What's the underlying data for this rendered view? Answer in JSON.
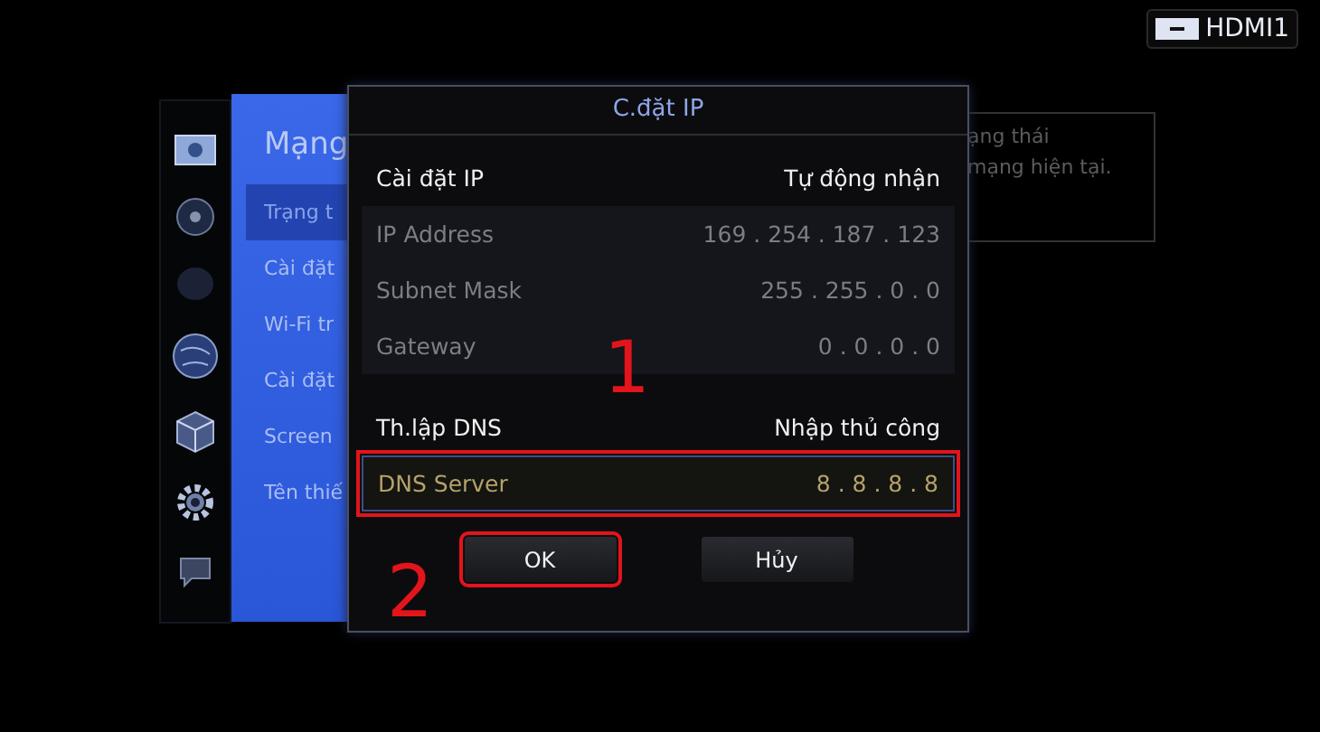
{
  "source_badge": {
    "label": "HDMI1"
  },
  "side_icons": [
    {
      "kind": "picture"
    },
    {
      "kind": "disc"
    },
    {
      "kind": "dot"
    },
    {
      "kind": "globe"
    },
    {
      "kind": "cube"
    },
    {
      "kind": "gear"
    },
    {
      "kind": "chat"
    }
  ],
  "menu": {
    "title": "Mạng",
    "items": [
      {
        "label": "Trạng t",
        "selected": true
      },
      {
        "label": "Cài đặt",
        "selected": false
      },
      {
        "label": "Wi-Fi tr",
        "selected": false
      },
      {
        "label": "Cài đặt",
        "selected": false
      },
      {
        "label": "Screen",
        "selected": false
      },
      {
        "label": "Tên thiế",
        "selected": false
      }
    ]
  },
  "info_panel": {
    "lines": [
      "ạng thái",
      "mạng hiện tại."
    ]
  },
  "dialog": {
    "title": "C.đặt IP",
    "rows": [
      {
        "label": "Cài đặt IP",
        "value": "Tự động nhận",
        "disabled": false,
        "selected": false,
        "annotated": false
      },
      {
        "label": "IP Address",
        "value": "169 . 254 . 187 . 123",
        "disabled": true,
        "selected": false,
        "annotated": false
      },
      {
        "label": "Subnet Mask",
        "value": "255 . 255 . 0 . 0",
        "disabled": true,
        "selected": false,
        "annotated": false
      },
      {
        "label": "Gateway",
        "value": "0 . 0 . 0 . 0",
        "disabled": true,
        "selected": false,
        "annotated": false
      },
      {
        "label": "Th.lập DNS",
        "value": "Nhập thủ công",
        "disabled": false,
        "selected": false,
        "annotated": false
      },
      {
        "label": "DNS Server",
        "value": "8 . 8 . 8 . 8",
        "disabled": false,
        "selected": true,
        "annotated": true
      }
    ],
    "buttons": [
      {
        "label": "OK",
        "annotated": true
      },
      {
        "label": "Hủy",
        "annotated": false
      }
    ]
  },
  "step_numbers": [
    "1",
    "2"
  ]
}
